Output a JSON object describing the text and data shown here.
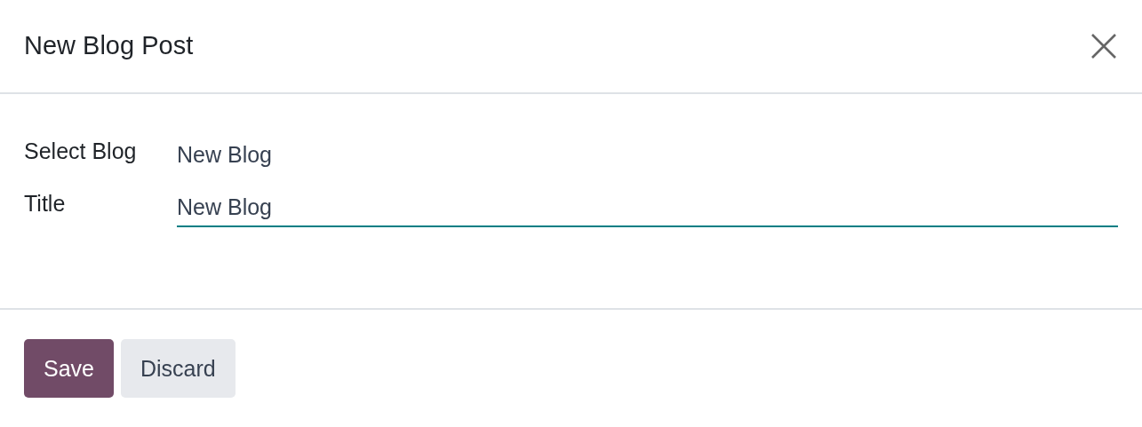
{
  "dialog": {
    "title": "New Blog Post"
  },
  "fields": [
    {
      "kind": "readonly",
      "label": "Select Blog",
      "value": "New Blog"
    },
    {
      "kind": "input",
      "label": "Title",
      "value": "New Blog"
    }
  ],
  "buttons": [
    {
      "kind": "primary",
      "label": "Save"
    },
    {
      "kind": "secondary",
      "label": "Discard"
    }
  ]
}
